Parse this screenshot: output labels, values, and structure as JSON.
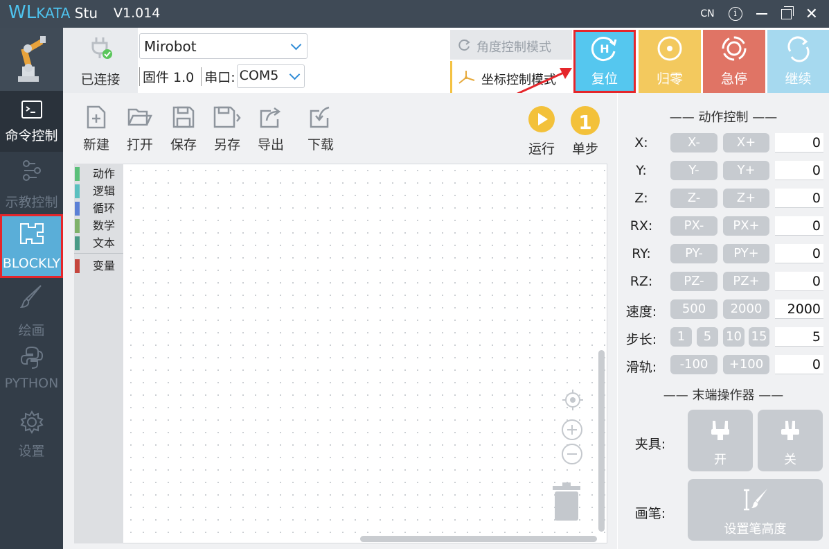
{
  "app": {
    "brand_wl": "WL",
    "brand_kata": "KATA",
    "brand_stu": " Stu",
    "version": "V1.014",
    "lang": "CN",
    "info": "i",
    "close": "✕"
  },
  "nav": {
    "command": "命令控制",
    "teach": "示教控制",
    "blockly": "BLOCKLY",
    "draw": "绘画",
    "python": "PYTHON",
    "settings": "设置"
  },
  "connection": {
    "status": "已连接",
    "device": "Mirobot",
    "firmware_label": "固件 1.0",
    "port_label": "串口:",
    "port": "COM5"
  },
  "modes": {
    "angle": "角度控制模式",
    "coord": "坐标控制模式"
  },
  "big_buttons": {
    "reset": "复位",
    "home": "归零",
    "stop": "急停",
    "continue": "继续"
  },
  "toolbar": {
    "new": "新建",
    "open": "打开",
    "save": "保存",
    "save_as": "另存",
    "export": "导出",
    "download": "下载",
    "run": "运行",
    "step": "单步",
    "step_num": "1"
  },
  "toolbox": [
    {
      "label": "动作",
      "color": "#5bc07a"
    },
    {
      "label": "逻辑",
      "color": "#5bc0c0"
    },
    {
      "label": "循环",
      "color": "#5b80d6"
    },
    {
      "label": "数学",
      "color": "#7fb26a"
    },
    {
      "label": "文本",
      "color": "#4a9a86"
    },
    {
      "label": "变量",
      "color": "#c5463e"
    }
  ],
  "motion": {
    "title": "—— 动作控制 ——",
    "rows": [
      {
        "label": "X:",
        "minus": "X-",
        "plus": "X+",
        "value": "0"
      },
      {
        "label": "Y:",
        "minus": "Y-",
        "plus": "Y+",
        "value": "0"
      },
      {
        "label": "Z:",
        "minus": "Z-",
        "plus": "Z+",
        "value": "0"
      },
      {
        "label": "RX:",
        "minus": "PX-",
        "plus": "PX+",
        "value": "0"
      },
      {
        "label": "RY:",
        "minus": "PY-",
        "plus": "PY+",
        "value": "0"
      },
      {
        "label": "RZ:",
        "minus": "PZ-",
        "plus": "PZ+",
        "value": "0"
      }
    ],
    "speed": {
      "label": "速度:",
      "a": "500",
      "b": "2000",
      "value": "2000"
    },
    "step": {
      "label": "步长:",
      "options": [
        "1",
        "5",
        "10",
        "15"
      ],
      "value": "5"
    },
    "rail": {
      "label": "滑轨:",
      "minus": "-100",
      "plus": "+100",
      "value": "0"
    }
  },
  "effector": {
    "title": "—— 末端操作器 ——",
    "gripper_label": "夹具:",
    "open": "开",
    "close": "关",
    "pen_label": "画笔:",
    "pen_height": "设置笔高度"
  }
}
